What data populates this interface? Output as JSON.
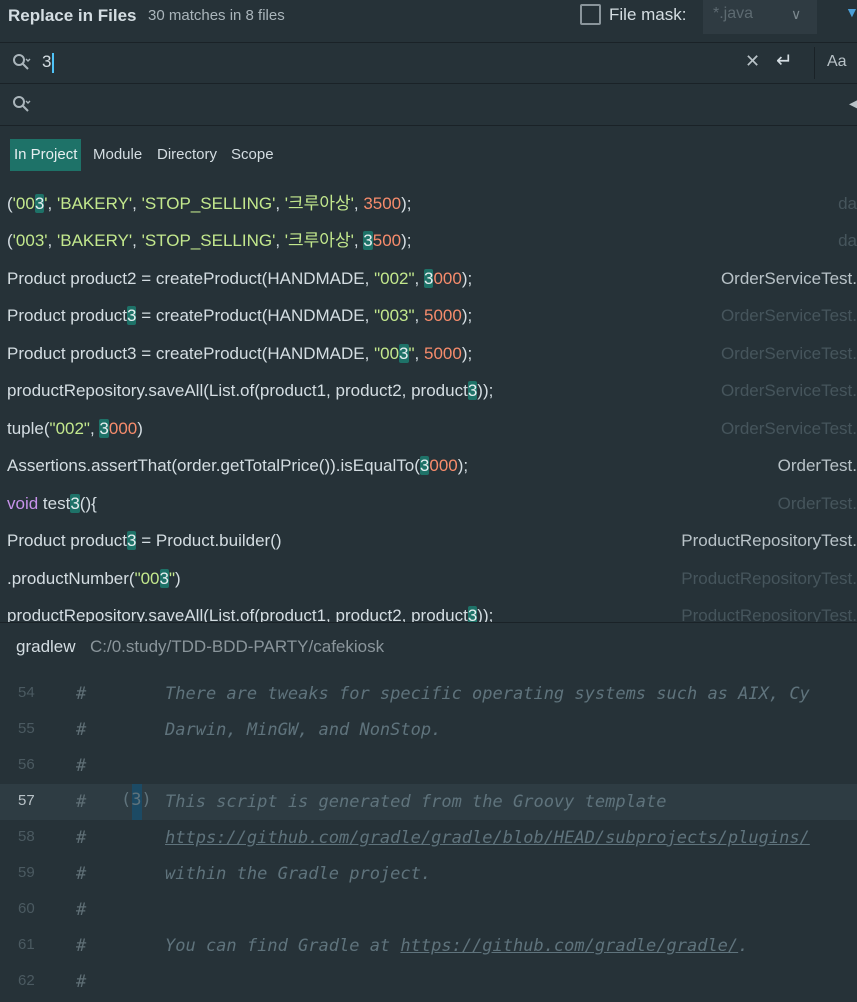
{
  "header": {
    "title": "Replace in Files",
    "match_count": "30 matches in 8 files",
    "file_mask_label": "File mask:",
    "file_mask_value": "*.java"
  },
  "search": {
    "value": "3"
  },
  "replace": {
    "value": ""
  },
  "options": {
    "match_case_label": "Aa"
  },
  "scope_tabs": [
    {
      "label": "In Project",
      "active": true
    },
    {
      "label": "Module"
    },
    {
      "label": "Directory"
    },
    {
      "label": "Scope"
    }
  ],
  "results": [
    {
      "file": "da"
    },
    {
      "file": "da"
    },
    {
      "file": "OrderServiceTest."
    },
    {
      "file": "OrderServiceTest."
    },
    {
      "file": "OrderServiceTest."
    },
    {
      "file": "OrderServiceTest."
    },
    {
      "file": "OrderServiceTest."
    },
    {
      "file": "OrderTest."
    },
    {
      "file": "OrderTest."
    },
    {
      "file": "ProductRepositoryTest."
    },
    {
      "file": "ProductRepositoryTest."
    },
    {
      "file": "ProductRepositoryTest."
    }
  ],
  "preview": {
    "file_name": "gradlew",
    "file_path": "C:/0.study/TDD-BDD-PARTY/cafekiosk",
    "lines": [
      {
        "num": "54",
        "text": "There are tweaks for specific operating systems such as AIX, Cy"
      },
      {
        "num": "55",
        "text": "Darwin, MinGW, and NonStop."
      },
      {
        "num": "56",
        "text": ""
      },
      {
        "num": "57",
        "text": "This script is generated from the Groovy template",
        "marker": "(3)"
      },
      {
        "num": "58",
        "text": "https://github.com/gradle/gradle/blob/HEAD/subprojects/plugins/"
      },
      {
        "num": "59",
        "text": "within the Gradle project."
      },
      {
        "num": "60",
        "text": ""
      },
      {
        "num": "61",
        "text_prefix": "You can find Gradle at ",
        "link": "https://github.com/gradle/gradle/",
        "text_suffix": "."
      },
      {
        "num": "62",
        "text": ""
      }
    ]
  }
}
